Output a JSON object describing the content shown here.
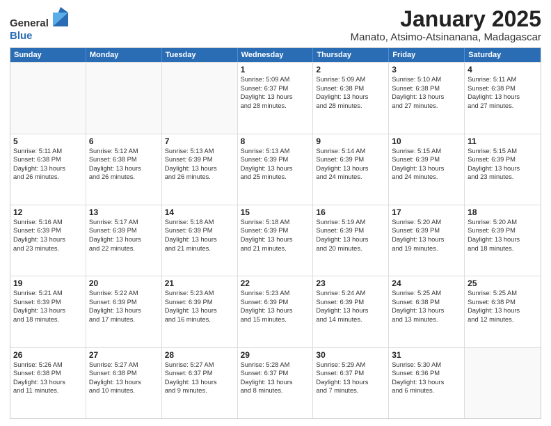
{
  "logo": {
    "general": "General",
    "blue": "Blue"
  },
  "title": "January 2025",
  "subtitle": "Manato, Atsimo-Atsinanana, Madagascar",
  "weekdays": [
    "Sunday",
    "Monday",
    "Tuesday",
    "Wednesday",
    "Thursday",
    "Friday",
    "Saturday"
  ],
  "rows": [
    [
      {
        "day": "",
        "lines": []
      },
      {
        "day": "",
        "lines": []
      },
      {
        "day": "",
        "lines": []
      },
      {
        "day": "1",
        "lines": [
          "Sunrise: 5:09 AM",
          "Sunset: 6:37 PM",
          "Daylight: 13 hours",
          "and 28 minutes."
        ]
      },
      {
        "day": "2",
        "lines": [
          "Sunrise: 5:09 AM",
          "Sunset: 6:38 PM",
          "Daylight: 13 hours",
          "and 28 minutes."
        ]
      },
      {
        "day": "3",
        "lines": [
          "Sunrise: 5:10 AM",
          "Sunset: 6:38 PM",
          "Daylight: 13 hours",
          "and 27 minutes."
        ]
      },
      {
        "day": "4",
        "lines": [
          "Sunrise: 5:11 AM",
          "Sunset: 6:38 PM",
          "Daylight: 13 hours",
          "and 27 minutes."
        ]
      }
    ],
    [
      {
        "day": "5",
        "lines": [
          "Sunrise: 5:11 AM",
          "Sunset: 6:38 PM",
          "Daylight: 13 hours",
          "and 26 minutes."
        ]
      },
      {
        "day": "6",
        "lines": [
          "Sunrise: 5:12 AM",
          "Sunset: 6:38 PM",
          "Daylight: 13 hours",
          "and 26 minutes."
        ]
      },
      {
        "day": "7",
        "lines": [
          "Sunrise: 5:13 AM",
          "Sunset: 6:39 PM",
          "Daylight: 13 hours",
          "and 26 minutes."
        ]
      },
      {
        "day": "8",
        "lines": [
          "Sunrise: 5:13 AM",
          "Sunset: 6:39 PM",
          "Daylight: 13 hours",
          "and 25 minutes."
        ]
      },
      {
        "day": "9",
        "lines": [
          "Sunrise: 5:14 AM",
          "Sunset: 6:39 PM",
          "Daylight: 13 hours",
          "and 24 minutes."
        ]
      },
      {
        "day": "10",
        "lines": [
          "Sunrise: 5:15 AM",
          "Sunset: 6:39 PM",
          "Daylight: 13 hours",
          "and 24 minutes."
        ]
      },
      {
        "day": "11",
        "lines": [
          "Sunrise: 5:15 AM",
          "Sunset: 6:39 PM",
          "Daylight: 13 hours",
          "and 23 minutes."
        ]
      }
    ],
    [
      {
        "day": "12",
        "lines": [
          "Sunrise: 5:16 AM",
          "Sunset: 6:39 PM",
          "Daylight: 13 hours",
          "and 23 minutes."
        ]
      },
      {
        "day": "13",
        "lines": [
          "Sunrise: 5:17 AM",
          "Sunset: 6:39 PM",
          "Daylight: 13 hours",
          "and 22 minutes."
        ]
      },
      {
        "day": "14",
        "lines": [
          "Sunrise: 5:18 AM",
          "Sunset: 6:39 PM",
          "Daylight: 13 hours",
          "and 21 minutes."
        ]
      },
      {
        "day": "15",
        "lines": [
          "Sunrise: 5:18 AM",
          "Sunset: 6:39 PM",
          "Daylight: 13 hours",
          "and 21 minutes."
        ]
      },
      {
        "day": "16",
        "lines": [
          "Sunrise: 5:19 AM",
          "Sunset: 6:39 PM",
          "Daylight: 13 hours",
          "and 20 minutes."
        ]
      },
      {
        "day": "17",
        "lines": [
          "Sunrise: 5:20 AM",
          "Sunset: 6:39 PM",
          "Daylight: 13 hours",
          "and 19 minutes."
        ]
      },
      {
        "day": "18",
        "lines": [
          "Sunrise: 5:20 AM",
          "Sunset: 6:39 PM",
          "Daylight: 13 hours",
          "and 18 minutes."
        ]
      }
    ],
    [
      {
        "day": "19",
        "lines": [
          "Sunrise: 5:21 AM",
          "Sunset: 6:39 PM",
          "Daylight: 13 hours",
          "and 18 minutes."
        ]
      },
      {
        "day": "20",
        "lines": [
          "Sunrise: 5:22 AM",
          "Sunset: 6:39 PM",
          "Daylight: 13 hours",
          "and 17 minutes."
        ]
      },
      {
        "day": "21",
        "lines": [
          "Sunrise: 5:23 AM",
          "Sunset: 6:39 PM",
          "Daylight: 13 hours",
          "and 16 minutes."
        ]
      },
      {
        "day": "22",
        "lines": [
          "Sunrise: 5:23 AM",
          "Sunset: 6:39 PM",
          "Daylight: 13 hours",
          "and 15 minutes."
        ]
      },
      {
        "day": "23",
        "lines": [
          "Sunrise: 5:24 AM",
          "Sunset: 6:39 PM",
          "Daylight: 13 hours",
          "and 14 minutes."
        ]
      },
      {
        "day": "24",
        "lines": [
          "Sunrise: 5:25 AM",
          "Sunset: 6:38 PM",
          "Daylight: 13 hours",
          "and 13 minutes."
        ]
      },
      {
        "day": "25",
        "lines": [
          "Sunrise: 5:25 AM",
          "Sunset: 6:38 PM",
          "Daylight: 13 hours",
          "and 12 minutes."
        ]
      }
    ],
    [
      {
        "day": "26",
        "lines": [
          "Sunrise: 5:26 AM",
          "Sunset: 6:38 PM",
          "Daylight: 13 hours",
          "and 11 minutes."
        ]
      },
      {
        "day": "27",
        "lines": [
          "Sunrise: 5:27 AM",
          "Sunset: 6:38 PM",
          "Daylight: 13 hours",
          "and 10 minutes."
        ]
      },
      {
        "day": "28",
        "lines": [
          "Sunrise: 5:27 AM",
          "Sunset: 6:37 PM",
          "Daylight: 13 hours",
          "and 9 minutes."
        ]
      },
      {
        "day": "29",
        "lines": [
          "Sunrise: 5:28 AM",
          "Sunset: 6:37 PM",
          "Daylight: 13 hours",
          "and 8 minutes."
        ]
      },
      {
        "day": "30",
        "lines": [
          "Sunrise: 5:29 AM",
          "Sunset: 6:37 PM",
          "Daylight: 13 hours",
          "and 7 minutes."
        ]
      },
      {
        "day": "31",
        "lines": [
          "Sunrise: 5:30 AM",
          "Sunset: 6:36 PM",
          "Daylight: 13 hours",
          "and 6 minutes."
        ]
      },
      {
        "day": "",
        "lines": []
      }
    ]
  ]
}
